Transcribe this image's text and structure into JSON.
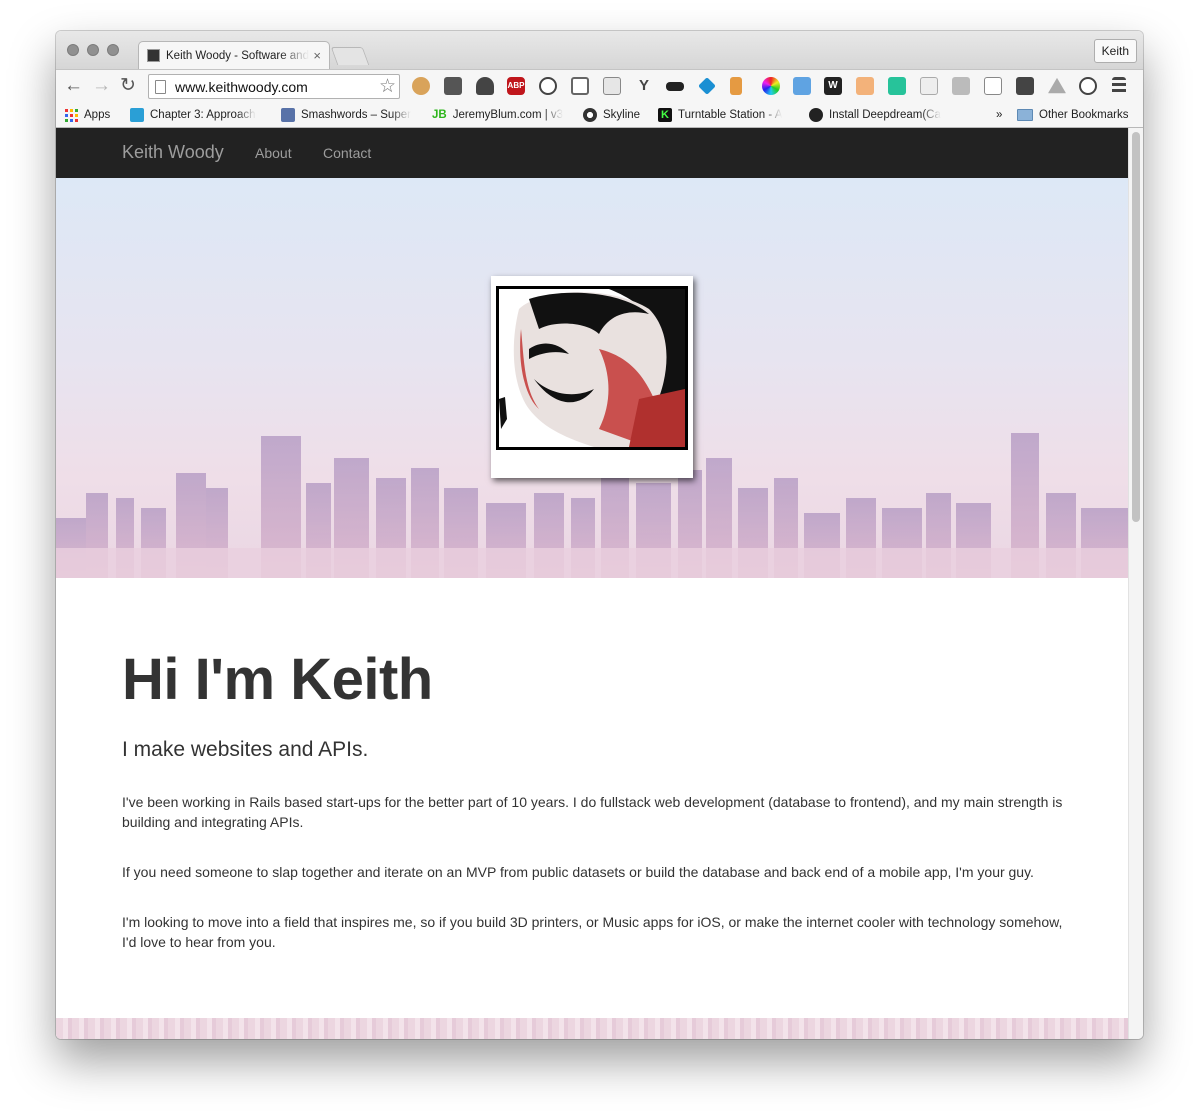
{
  "browser": {
    "tab": {
      "title": "Keith Woody - Software and",
      "close": "×"
    },
    "profile": "Keith",
    "url": "www.keithwoody.com",
    "nav": {
      "back": "←",
      "forward": "→",
      "reload": "↻"
    },
    "extensions": [
      "cookie-icon",
      "pocket-icon",
      "evernote-icon",
      "adblock-plus-icon",
      "ghostery-icon",
      "cast-icon",
      "clipper-icon",
      "ycombinator-icon",
      "disguise-icon",
      "diamond-icon",
      "tag-icon",
      "color-wheel-icon",
      "screenshot-icon",
      "w-icon",
      "face-icon",
      "bot-icon",
      "blank-icon",
      "window-icon",
      "tablet-icon",
      "shield-icon",
      "drive-icon",
      "info-icon",
      "menu-icon"
    ],
    "extension_labels": {
      "adblock": "ABP",
      "y": "Y",
      "w": "W"
    },
    "bookmarks": [
      {
        "label": "Apps"
      },
      {
        "label": "Chapter 3: Approach"
      },
      {
        "label": "Smashwords – Super"
      },
      {
        "label": "JeremyBlum.com | v3",
        "icon_text": "JB"
      },
      {
        "label": "Skyline"
      },
      {
        "label": "Turntable Station - A",
        "icon_text": "K"
      },
      {
        "label": "Install Deepdream(Ca"
      }
    ],
    "more_bookmarks": "»",
    "other_bookmarks": "Other Bookmarks"
  },
  "site": {
    "brand": "Keith Woody",
    "nav": [
      "About",
      "Contact"
    ],
    "heading": "Hi I'm Keith",
    "lead": "I make websites and APIs.",
    "paragraphs": [
      "I've been working in Rails based start-ups for the better part of 10 years. I do fullstack web development (database to frontend), and my main strength is building and integrating APIs.",
      "If you need someone to slap together and iterate on an MVP from public datasets or build the database and back end of a mobile app, I'm your guy.",
      "I'm looking to move into a field that inspires me, so if you build 3D printers, or Music apps for iOS, or make the internet cooler with technology somehow, I'd love to hear from you."
    ]
  },
  "colors": {
    "navbar": "#222222",
    "nav_text": "#9d9d9d",
    "text": "#333333",
    "hero_sky": "#dde8f6",
    "hero_skyline": "#c9a9c4"
  }
}
